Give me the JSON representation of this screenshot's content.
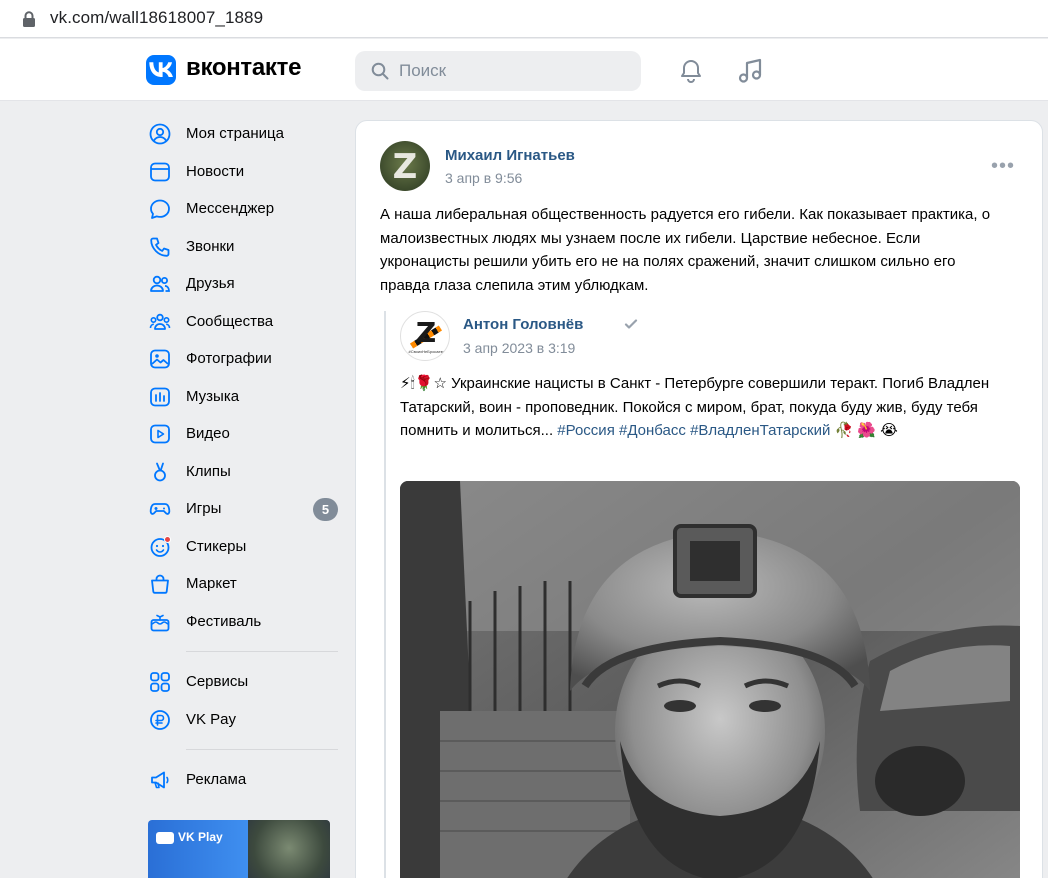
{
  "browser": {
    "url": "vk.com/wall18618007_1889"
  },
  "header": {
    "brand": "вконтакте",
    "search_placeholder": "Поиск"
  },
  "sidebar": {
    "items": [
      {
        "label": "Моя страница",
        "icon": "user-circle-icon"
      },
      {
        "label": "Новости",
        "icon": "news-icon"
      },
      {
        "label": "Мессенджер",
        "icon": "message-icon"
      },
      {
        "label": "Звонки",
        "icon": "phone-icon"
      },
      {
        "label": "Друзья",
        "icon": "friends-icon"
      },
      {
        "label": "Сообщества",
        "icon": "communities-icon"
      },
      {
        "label": "Фотографии",
        "icon": "photo-icon"
      },
      {
        "label": "Музыка",
        "icon": "music-icon"
      },
      {
        "label": "Видео",
        "icon": "video-icon"
      },
      {
        "label": "Клипы",
        "icon": "clips-icon"
      },
      {
        "label": "Игры",
        "icon": "games-icon",
        "badge": "5"
      },
      {
        "label": "Стикеры",
        "icon": "stickers-icon"
      },
      {
        "label": "Маркет",
        "icon": "market-icon"
      },
      {
        "label": "Фестиваль",
        "icon": "festival-icon"
      }
    ],
    "group2": [
      {
        "label": "Сервисы",
        "icon": "services-icon"
      },
      {
        "label": "VK Pay",
        "icon": "vkpay-icon"
      }
    ],
    "group3": [
      {
        "label": "Реклама",
        "icon": "ads-icon"
      }
    ],
    "promo": {
      "label": "VK Play"
    }
  },
  "post": {
    "author": "Михаил Игнатьев",
    "time": "3 апр в 9:56",
    "avatar_letter": "Z",
    "text": "А наша либеральная общественность радуется его гибели. Как показывает практика, о малоизвестных людях мы узнаем после их гибели. Царствие небесное. Если укронацисты решили убить его не на полях сражений, значит слишком сильно его правда глаза слепила этим ублюдкам.",
    "repost": {
      "author": "Антон Головнёв",
      "time": "3 апр 2023 в 3:19",
      "avatar_letter": "Z",
      "avatar_caption": "#СвоихНеБросаем",
      "text_plain": "⚡🕯🌹☆ Украинские нацисты в Санкт - Петербурге совершили теракт. Погиб Владлен Татарский, воин - проповедник. Покойся с миром, брат, покуда буду жив, буду тебя помнить и молиться... ",
      "tags": [
        "#Россия",
        "#Донбасс",
        "#ВладленТатарский"
      ],
      "text_tail": " 🥀 🌺 😭"
    }
  },
  "colors": {
    "accent": "#0077ff",
    "link": "#2a5885",
    "muted": "#818c99",
    "page_bg": "#edeef0"
  }
}
